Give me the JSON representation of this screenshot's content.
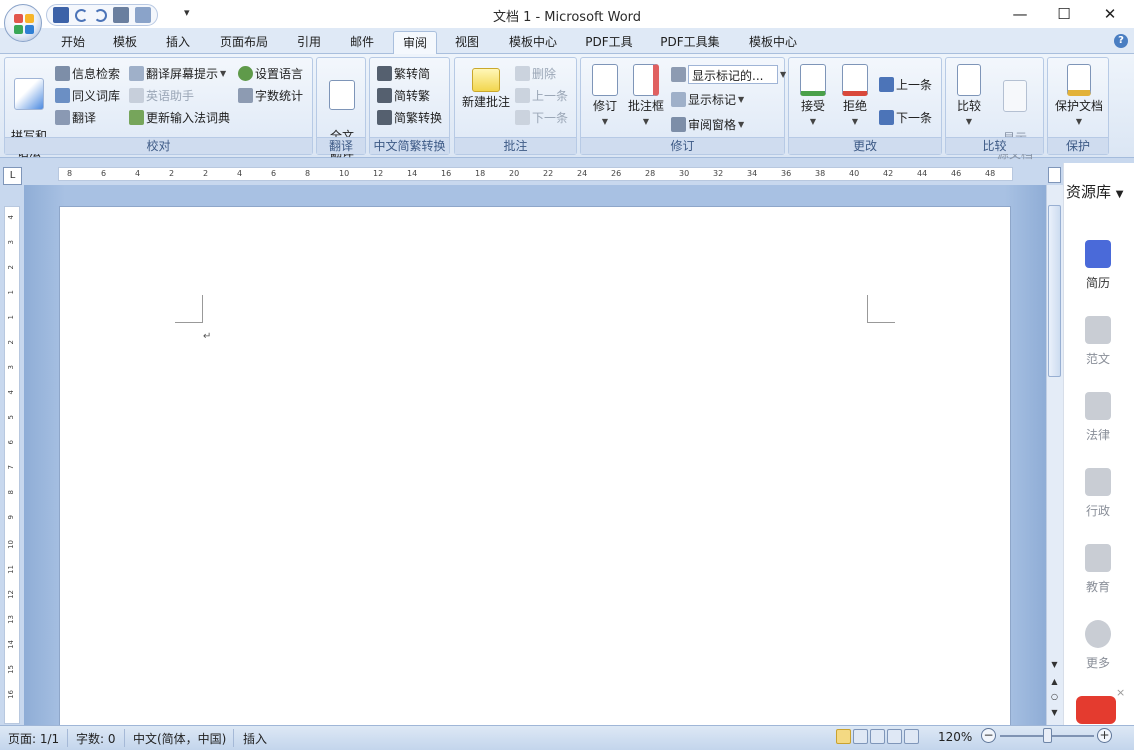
{
  "window": {
    "title": "文档 1 - Microsoft Word"
  },
  "title_controls": {
    "minimize": "—",
    "maximize": "☐",
    "close": "✕"
  },
  "qat": {
    "more": "▾"
  },
  "tabs": [
    "开始",
    "模板",
    "插入",
    "页面布局",
    "引用",
    "邮件",
    "审阅",
    "视图",
    "模板中心",
    "PDF工具",
    "PDF工具集",
    "模板中心"
  ],
  "active_tab": "审阅",
  "help": "?",
  "ribbon": {
    "proofing": {
      "label": "校对",
      "spell": "拼写和\n语法",
      "research": "信息检索",
      "thesaurus": "同义词库",
      "translate": "翻译",
      "screen_tip": "翻译屏幕提示",
      "english_assist": "英语助手",
      "update_ime": "更新输入法词典",
      "set_language": "设置语言",
      "word_count": "字数统计"
    },
    "translation": {
      "label": "翻译",
      "full": "全文\n翻译"
    },
    "chinese": {
      "label": "中文简繁转换",
      "to_simplified": "繁转简",
      "to_traditional": "简转繁",
      "convert": "简繁转换"
    },
    "comments": {
      "label": "批注",
      "new": "新建批注",
      "delete": "删除",
      "prev": "上一条",
      "next": "下一条"
    },
    "tracking": {
      "label": "修订",
      "track": "修订",
      "balloons": "批注框",
      "display": "显示标记的...",
      "show_markup": "显示标记",
      "pane": "审阅窗格"
    },
    "changes": {
      "label": "更改",
      "accept": "接受",
      "reject": "拒绝",
      "prev": "上一条",
      "next": "下一条"
    },
    "compare": {
      "label": "比较",
      "compare": "比较",
      "show_source": "显示\n源文档"
    },
    "protect": {
      "label": "保护",
      "protect_doc": "保护文档"
    }
  },
  "ruler": {
    "corner": "L",
    "h_ticks": [
      "8",
      "6",
      "4",
      "2",
      "2",
      "4",
      "6",
      "8",
      "10",
      "12",
      "14",
      "16",
      "18",
      "20",
      "22",
      "24",
      "26",
      "28",
      "30",
      "32",
      "34",
      "36",
      "38",
      "40",
      "42",
      "44",
      "46",
      "48"
    ],
    "v_ticks": [
      "4",
      "3",
      "2",
      "1",
      "1",
      "2",
      "3",
      "4",
      "5",
      "6",
      "7",
      "8",
      "9",
      "10",
      "11",
      "12",
      "13",
      "14",
      "15",
      "16"
    ]
  },
  "document": {
    "paragraph_mark": "↵"
  },
  "resource_panel": {
    "title": "资源库",
    "items": [
      "简历",
      "范文",
      "法律",
      "行政",
      "教育",
      "更多"
    ]
  },
  "statusbar": {
    "page": "页面: 1/1",
    "words": "字数: 0",
    "language": "中文(简体，中国)",
    "mode": "插入",
    "zoom": "120%"
  }
}
